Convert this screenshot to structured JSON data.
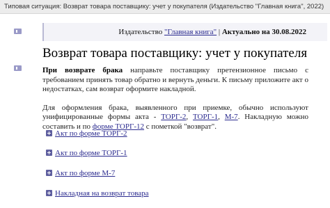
{
  "breadcrumb": "Типовая ситуация: Возврат товара поставщику: учет у покупателя (Издательство \"Главная книга\", 2022)",
  "publisher": {
    "prefix": "Издательство ",
    "name": "\"Главная книга\"",
    "separator": " | ",
    "actual": "Актуально на 30.08.2022"
  },
  "title": "Возврат товара поставщику: учет у покупателя",
  "para1": {
    "bold": "При возврате брака",
    "text": " направьте поставщику претензионное письмо с требованием принять товар обратно и вернуть деньги. К письму приложите акт о недостатках, сам возврат оформите накладной."
  },
  "para2": {
    "t1": "Для оформления брака, выявленного при приемке, обычно используют унифицированные формы акта - ",
    "l1": "ТОРГ-2",
    "t2": ", ",
    "l2": "ТОРГ-1",
    "t3": ", ",
    "l3": "М-7",
    "t4": ". Накладную можно составить и по ",
    "l4": "форме ТОРГ-12",
    "t5": " с пометкой \"возврат\"."
  },
  "attachments": [
    "Акт по форме ТОРГ-2",
    "Акт по форме ТОРГ-1",
    "Акт по форме М-7",
    "Накладная на возврат товара"
  ]
}
